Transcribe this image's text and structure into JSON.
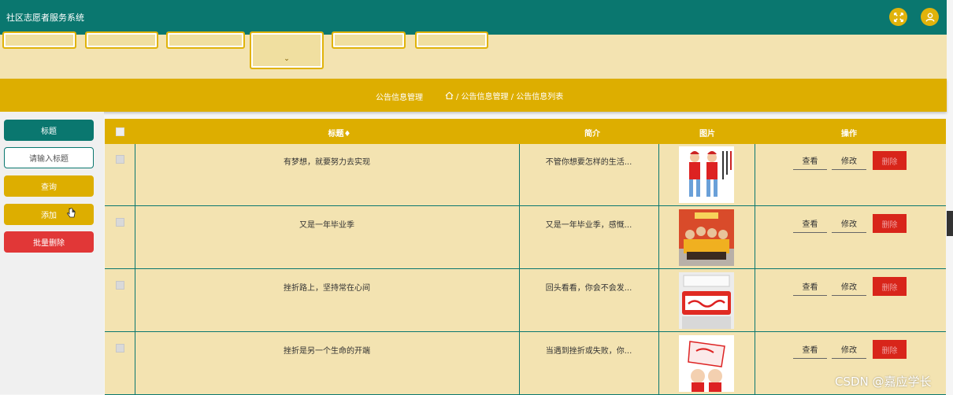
{
  "app": {
    "title": "社区志愿者服务系统"
  },
  "header": {
    "fullscreen_icon": "expand-arrows-icon",
    "user_icon": "user-icon",
    "accent": "#0a776f",
    "gold": "#ddae00"
  },
  "breadcrumb": {
    "section": "公告信息管理",
    "path": "/ 公告信息管理 / 公告信息列表"
  },
  "sidebar": {
    "title_label": "标题",
    "search_placeholder": "请输入标题",
    "query_label": "查询",
    "add_label": "添加",
    "batch_delete_label": "批量删除"
  },
  "table": {
    "headers": {
      "title": "标题♦",
      "summary": "简介",
      "image": "图片",
      "actions": "操作"
    },
    "actions": {
      "view": "查看",
      "edit": "修改",
      "delete": "删除"
    },
    "rows": [
      {
        "title": "有梦想，就要努力去实现",
        "summary": "不管你想要怎样的生活...",
        "image": "volunteer-kids-illustration"
      },
      {
        "title": "又是一年毕业季",
        "summary": "又是一年毕业季，感慨...",
        "image": "graduation-group-photo"
      },
      {
        "title": "挫折路上，坚持常在心间",
        "summary": "回头看看，你会不会发...",
        "image": "red-banner-sign"
      },
      {
        "title": "挫折是另一个生命的开端",
        "summary": "当遇到挫折或失败，你...",
        "image": "volunteer-flag-illustration"
      }
    ]
  },
  "watermark": "CSDN @嘉应学长"
}
